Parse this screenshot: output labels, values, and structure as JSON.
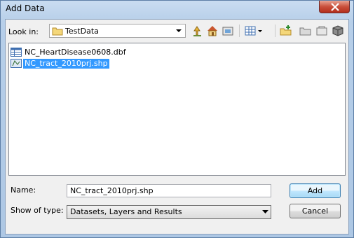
{
  "window": {
    "title": "Add Data"
  },
  "lookin": {
    "label": "Look in:",
    "folder": "TestData"
  },
  "toolbar": {
    "icons": [
      "up-one-level-icon",
      "home-icon",
      "catalog-icon",
      "view-toggle-icon",
      "new-folder-icon",
      "connect-folder-icon",
      "disconnect-folder-icon",
      "database-icon"
    ]
  },
  "files": [
    {
      "name": "NC_HeartDisease0608.dbf",
      "icon": "table-icon",
      "selected": false
    },
    {
      "name": "NC_tract_2010prj.shp",
      "icon": "shapefile-icon",
      "selected": true
    }
  ],
  "form": {
    "name_label": "Name:",
    "name_value": "NC_tract_2010prj.shp",
    "type_label": "Show of type:",
    "type_value": "Datasets, Layers and Results"
  },
  "buttons": {
    "add": "Add",
    "cancel": "Cancel"
  }
}
